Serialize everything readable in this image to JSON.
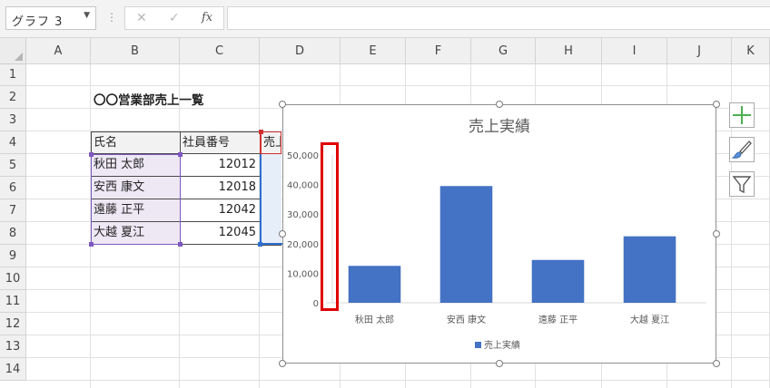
{
  "formula_bar": {
    "name_box": "グラフ 3",
    "cancel_glyph": "✕",
    "enter_glyph": "✓",
    "fx_label": "fx",
    "formula": ""
  },
  "columns": [
    "A",
    "B",
    "C",
    "D",
    "E",
    "F",
    "G",
    "H",
    "I",
    "J",
    "K"
  ],
  "rows": [
    "1",
    "2",
    "3",
    "4",
    "5",
    "6",
    "7",
    "8",
    "9",
    "10",
    "11",
    "12",
    "13",
    "14"
  ],
  "sheet": {
    "title": "〇〇営業部売上一覧",
    "headers": [
      "氏名",
      "社員番号",
      "売上実績"
    ],
    "records": [
      {
        "name": "秋田 太郎",
        "id": "12012"
      },
      {
        "name": "安西 康文",
        "id": "12018"
      },
      {
        "name": "遠藤 正平",
        "id": "12042"
      },
      {
        "name": "大越 夏江",
        "id": "12045"
      }
    ]
  },
  "chart_data": {
    "type": "bar",
    "title": "売上実績",
    "categories": [
      "秋田 太郎",
      "安西 康文",
      "遠藤 正平",
      "大越 夏江"
    ],
    "series": [
      {
        "name": "売上実績",
        "values": [
          12500,
          39500,
          14500,
          22500
        ],
        "color": "#4472c4"
      }
    ],
    "ylim": [
      0,
      50000
    ],
    "yticks": [
      "0",
      "10,000",
      "20,000",
      "30,000",
      "40,000",
      "50,000"
    ],
    "legend": "bottom",
    "grid": false,
    "highlight_color": "#e00000"
  },
  "chart_buttons": [
    "plus-icon",
    "brush-icon",
    "filter-icon"
  ]
}
